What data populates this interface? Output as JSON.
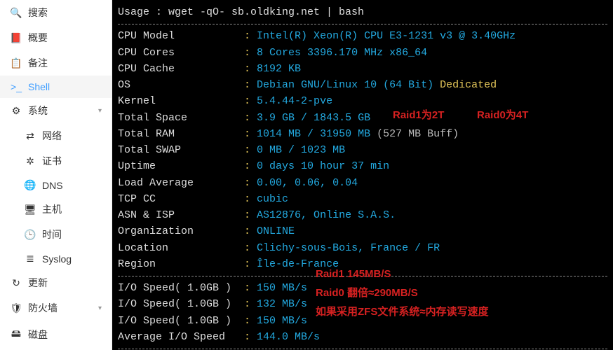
{
  "sidebar": {
    "items": [
      {
        "icon": "🔍",
        "label": "搜索"
      },
      {
        "icon": "📕",
        "label": "概要"
      },
      {
        "icon": "📋",
        "label": "备注"
      },
      {
        "icon": ">_",
        "label": "Shell"
      },
      {
        "icon": "⚙",
        "label": "系统",
        "expand": true
      },
      {
        "icon": "⇄",
        "label": "网络"
      },
      {
        "icon": "✲",
        "label": "证书"
      },
      {
        "icon": "🌐",
        "label": "DNS"
      },
      {
        "icon": "🖥",
        "label": "主机"
      },
      {
        "icon": "🕒",
        "label": "时间"
      },
      {
        "icon": "≣",
        "label": "Syslog"
      },
      {
        "icon": "↻",
        "label": "更新"
      },
      {
        "icon": "🛡",
        "label": "防火墙",
        "expand": true
      },
      {
        "icon": "🖴",
        "label": "磁盘"
      }
    ]
  },
  "term": {
    "usage": "Usage : wget -qO- sb.oldking.net | bash",
    "cpu_model_k": "CPU Model           ",
    "cpu_model_v": " Intel(R) Xeon(R) CPU E3-1231 v3 @ 3.40GHz",
    "cpu_cores_k": "CPU Cores           ",
    "cpu_cores_v": " 8 Cores 3396.170 MHz x86_64",
    "cpu_cache_k": "CPU Cache           ",
    "cpu_cache_v": " 8192 KB",
    "os_k": "OS                  ",
    "os_v": " Debian GNU/Linux 10 (64 Bit) ",
    "os_tag": "Dedicated",
    "kernel_k": "Kernel              ",
    "kernel_v": " 5.4.44-2-pve",
    "tspace_k": "Total Space         ",
    "tspace_v": " 3.9 GB / 1843.5 GB",
    "tram_k": "Total RAM           ",
    "tram_v": " 1014 MB / 31950 MB ",
    "tram_buf": "(527 MB Buff)",
    "tswap_k": "Total SWAP          ",
    "tswap_v": " 0 MB / 1023 MB",
    "uptime_k": "Uptime              ",
    "uptime_v": " 0 days 10 hour 37 min",
    "load_k": "Load Average        ",
    "load_v": " 0.00, 0.06, 0.04",
    "tcp_k": "TCP CC              ",
    "tcp_v": " cubic",
    "asn_k": "ASN & ISP           ",
    "asn_v": " AS12876, Online S.A.S.",
    "org_k": "Organization        ",
    "org_v": " ONLINE",
    "loc_k": "Location            ",
    "loc_v": " Clichy-sous-Bois, France / FR",
    "reg_k": "Region              ",
    "reg_v": " Île-de-France",
    "io1_k": "I/O Speed( 1.0GB )  ",
    "io1_v": " 150 MB/s",
    "io2_k": "I/O Speed( 1.0GB )  ",
    "io2_v": " 132 MB/s",
    "io3_k": "I/O Speed( 1.0GB )  ",
    "io3_v": " 150 MB/s",
    "ioa_k": "Average I/O Speed   ",
    "ioa_v": " 144.0 MB/s",
    "colon": ":"
  },
  "annotations": {
    "a1a": "Raid1为2T",
    "a1b": "Raid0为4T",
    "a2": "Raid1 145MB/S",
    "a3": "Raid0 翻倍≈290MB/S",
    "a4": "如果采用ZFS文件系统≈内存读写速度"
  }
}
